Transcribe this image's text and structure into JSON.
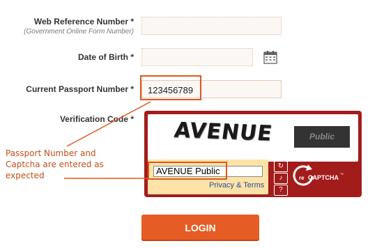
{
  "form": {
    "web_ref_label": "Web Reference Number *",
    "web_ref_sub": "(Government Online Form Number)",
    "web_ref_value": "",
    "dob_label": "Date of Birth *",
    "dob_value": "",
    "passport_label": "Current Passport Number *",
    "passport_value": "123456789",
    "verification_label": "Verification Code *"
  },
  "captcha": {
    "word1": "AVENUE",
    "word2": "Public",
    "input_value": "AVENUE Public",
    "privacy_link": "Privacy & Terms",
    "logo_text": "reCAPTCHA",
    "logo_prefix": "re",
    "logo_suffix": "CAPTCHA",
    "logo_tm": "™"
  },
  "login_label": "LOGIN",
  "annotation": {
    "text": "Passport Number and Captcha are entered as expected",
    "color": "#e0561b"
  },
  "icons": [
    "calendar-icon",
    "refresh-icon",
    "audio-icon",
    "help-icon",
    "recaptcha-logo-icon"
  ]
}
